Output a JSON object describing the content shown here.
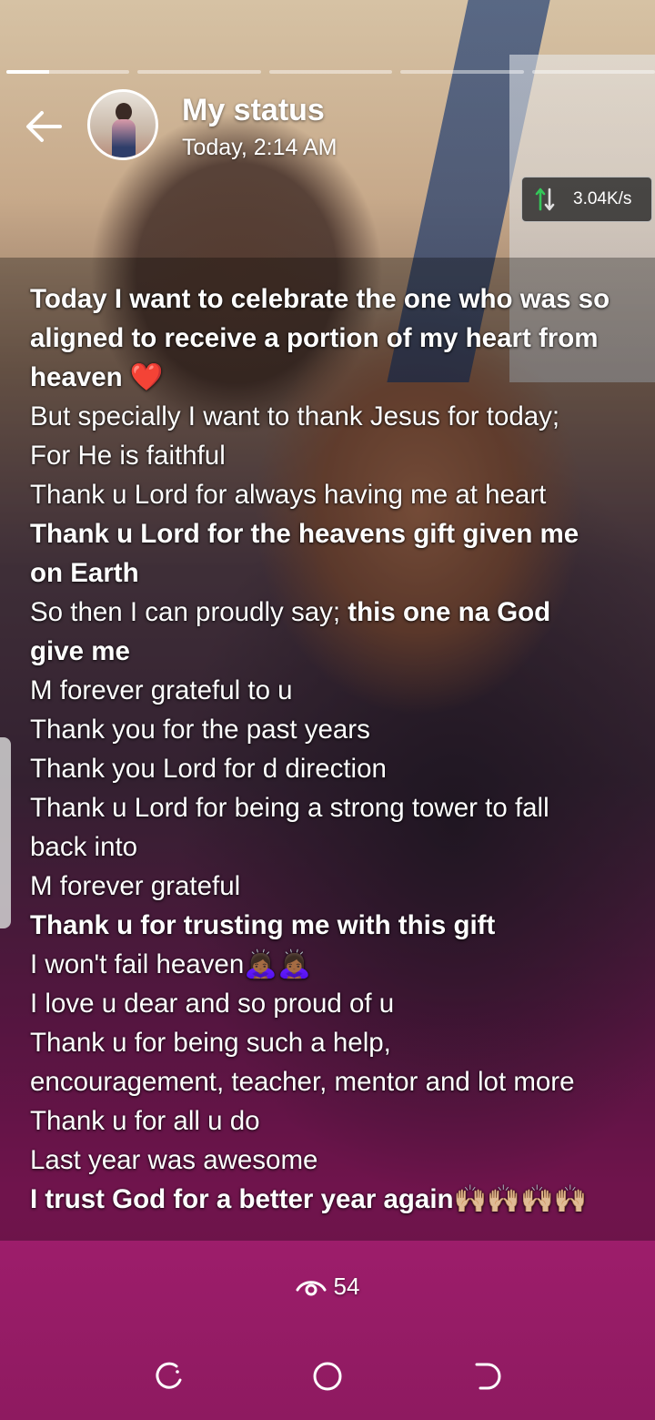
{
  "status": {
    "title": "My status",
    "timestamp": "Today, 2:14 AM",
    "segments": [
      {
        "progress": 0.35
      },
      {
        "progress": 0
      },
      {
        "progress": 0
      },
      {
        "progress": 0
      },
      {
        "progress": 0
      }
    ]
  },
  "net_speed": {
    "value": "3.04K/s",
    "icon": "up-down-arrows-icon"
  },
  "caption": {
    "lines": [
      [
        {
          "text": "Today I want to celebrate the one who was so",
          "bold": true
        }
      ],
      [
        {
          "text": "aligned to receive a portion of my heart from",
          "bold": true
        }
      ],
      [
        {
          "text": "heaven ❤️",
          "bold": true
        }
      ],
      [
        {
          "text": "But specially I want to thank Jesus for today;",
          "bold": false
        }
      ],
      [
        {
          "text": "For He is faithful",
          "bold": false
        }
      ],
      [
        {
          "text": "Thank u Lord for always having me at heart",
          "bold": false
        }
      ],
      [
        {
          "text": "Thank u Lord for the heavens gift given me",
          "bold": true
        }
      ],
      [
        {
          "text": "on Earth",
          "bold": true
        }
      ],
      [
        {
          "text": "So then I can proudly say; ",
          "bold": false
        },
        {
          "text": "this one na God",
          "bold": true
        }
      ],
      [
        {
          "text": "give me",
          "bold": true
        }
      ],
      [
        {
          "text": "M forever grateful to u",
          "bold": false
        }
      ],
      [
        {
          "text": "Thank you for the past years",
          "bold": false
        }
      ],
      [
        {
          "text": "Thank you Lord for d direction",
          "bold": false
        }
      ],
      [
        {
          "text": "Thank u Lord for being a strong tower to fall",
          "bold": false
        }
      ],
      [
        {
          "text": "back into",
          "bold": false
        }
      ],
      [
        {
          "text": "M forever grateful",
          "bold": false
        }
      ],
      [
        {
          "text": "Thank u for trusting me with this gift",
          "bold": true
        }
      ],
      [
        {
          "text": "I won't fail heaven🙇🏾‍♀️🙇🏾‍♀️",
          "bold": false
        }
      ],
      [
        {
          "text": "I love u dear and so proud of u",
          "bold": false
        }
      ],
      [
        {
          "text": "Thank u for being such a help,",
          "bold": false
        }
      ],
      [
        {
          "text": "encouragement, teacher, mentor and lot more",
          "bold": false
        }
      ],
      [
        {
          "text": "Thank u for all u do",
          "bold": false
        }
      ],
      [
        {
          "text": "Last year was awesome",
          "bold": false
        }
      ],
      [
        {
          "text": "I trust God for a better year again🙌🏼🙌🏼🙌🏼🙌🏼",
          "bold": true
        }
      ]
    ]
  },
  "views": {
    "count": "54",
    "icon": "eye-icon"
  },
  "navbar": {
    "items": [
      "recent-apps-icon",
      "home-icon",
      "back-nav-icon"
    ]
  }
}
